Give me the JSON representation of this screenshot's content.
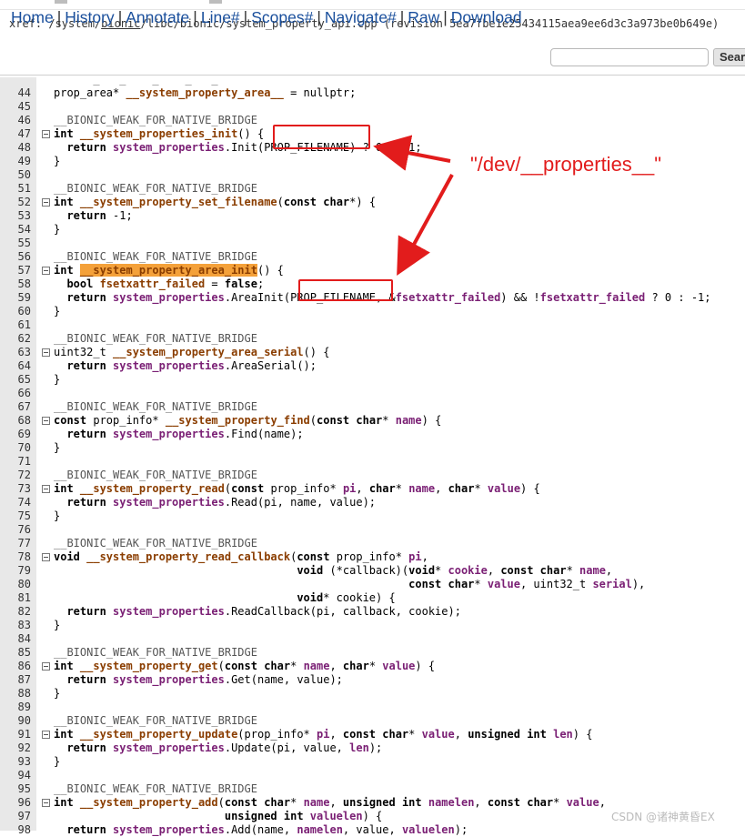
{
  "xref": {
    "prefix": "xref: /system/",
    "bionic_link": "bionic",
    "rest": "/libc/bionic/system_property_api.cpp (revision 5ea7fbe1e25434115aea9ee6d3c3a973be0b649e)"
  },
  "nav": {
    "items": [
      "Home",
      "History",
      "Annotate",
      "Line#",
      "Scopes#",
      "Navigate#",
      "Raw",
      "Download"
    ],
    "search_button": "Sear"
  },
  "annotation": {
    "text": "\"/dev/__properties__\"",
    "color": "#e21c1c"
  },
  "watermark": "CSDN @诸神黄昏EX",
  "colors": {
    "highlight": "#f4a13a",
    "function": "#8a3d00",
    "identifier": "#7a1f74",
    "nav_link": "#1a4f9c"
  },
  "lines": [
    {
      "n": "",
      "fold": false,
      "tokens": [
        [
          "      _   _    _    _   _   ",
          "mac"
        ]
      ]
    },
    {
      "n": "44",
      "fold": false,
      "tokens": [
        [
          "prop_area* ",
          ""
        ],
        [
          "__system_property_area__",
          "fn"
        ],
        [
          " = nullptr;",
          ""
        ]
      ]
    },
    {
      "n": "45",
      "fold": false,
      "tokens": []
    },
    {
      "n": "46",
      "fold": false,
      "tokens": [
        [
          "__BIONIC_WEAK_FOR_NATIVE_BRIDGE",
          "mac"
        ]
      ]
    },
    {
      "n": "47",
      "fold": true,
      "tokens": [
        [
          "int ",
          "kw"
        ],
        [
          "__system_properties_init",
          "fn"
        ],
        [
          "() {",
          ""
        ]
      ]
    },
    {
      "n": "48",
      "fold": false,
      "tokens": [
        [
          "  ",
          ""
        ],
        [
          "return ",
          "kw"
        ],
        [
          "system_properties",
          "var"
        ],
        [
          ".Init(PROP_FILENAME) ? 0 : -1;",
          ""
        ]
      ]
    },
    {
      "n": "49",
      "fold": false,
      "tokens": [
        [
          "}",
          ""
        ]
      ]
    },
    {
      "n": "50",
      "fold": false,
      "tokens": []
    },
    {
      "n": "51",
      "fold": false,
      "tokens": [
        [
          "__BIONIC_WEAK_FOR_NATIVE_BRIDGE",
          "mac"
        ]
      ]
    },
    {
      "n": "52",
      "fold": true,
      "tokens": [
        [
          "int ",
          "kw"
        ],
        [
          "__system_property_set_filename",
          "fn"
        ],
        [
          "(",
          ""
        ],
        [
          "const char",
          "kw"
        ],
        [
          "*) {",
          ""
        ]
      ]
    },
    {
      "n": "53",
      "fold": false,
      "tokens": [
        [
          "  ",
          ""
        ],
        [
          "return ",
          "kw"
        ],
        [
          "-1;",
          ""
        ]
      ]
    },
    {
      "n": "54",
      "fold": false,
      "tokens": [
        [
          "}",
          ""
        ]
      ]
    },
    {
      "n": "55",
      "fold": false,
      "tokens": []
    },
    {
      "n": "56",
      "fold": false,
      "tokens": [
        [
          "__BIONIC_WEAK_FOR_NATIVE_BRIDGE",
          "mac"
        ]
      ]
    },
    {
      "n": "57",
      "fold": true,
      "tokens": [
        [
          "int ",
          "kw"
        ],
        [
          "__system_property_area_init",
          "fn hl"
        ],
        [
          "() {",
          ""
        ]
      ]
    },
    {
      "n": "58",
      "fold": false,
      "tokens": [
        [
          "  ",
          ""
        ],
        [
          "bool ",
          "kw"
        ],
        [
          "fsetxattr_failed",
          "fn"
        ],
        [
          " = ",
          ""
        ],
        [
          "false",
          "kw"
        ],
        [
          ";",
          ""
        ]
      ]
    },
    {
      "n": "59",
      "fold": false,
      "tokens": [
        [
          "  ",
          ""
        ],
        [
          "return ",
          "kw"
        ],
        [
          "system_properties",
          "var"
        ],
        [
          ".AreaInit(PROP_FILENAME, &",
          ""
        ],
        [
          "fsetxattr_failed",
          "var"
        ],
        [
          ") && !",
          ""
        ],
        [
          "fsetxattr_failed",
          "var"
        ],
        [
          " ? 0 : -1;",
          ""
        ]
      ]
    },
    {
      "n": "60",
      "fold": false,
      "tokens": [
        [
          "}",
          ""
        ]
      ]
    },
    {
      "n": "61",
      "fold": false,
      "tokens": []
    },
    {
      "n": "62",
      "fold": false,
      "tokens": [
        [
          "__BIONIC_WEAK_FOR_NATIVE_BRIDGE",
          "mac"
        ]
      ]
    },
    {
      "n": "63",
      "fold": true,
      "tokens": [
        [
          "uint32_t ",
          ""
        ],
        [
          "__system_property_area_serial",
          "fn"
        ],
        [
          "() {",
          ""
        ]
      ]
    },
    {
      "n": "64",
      "fold": false,
      "tokens": [
        [
          "  ",
          ""
        ],
        [
          "return ",
          "kw"
        ],
        [
          "system_properties",
          "var"
        ],
        [
          ".AreaSerial();",
          ""
        ]
      ]
    },
    {
      "n": "65",
      "fold": false,
      "tokens": [
        [
          "}",
          ""
        ]
      ]
    },
    {
      "n": "66",
      "fold": false,
      "tokens": []
    },
    {
      "n": "67",
      "fold": false,
      "tokens": [
        [
          "__BIONIC_WEAK_FOR_NATIVE_BRIDGE",
          "mac"
        ]
      ]
    },
    {
      "n": "68",
      "fold": true,
      "tokens": [
        [
          "const ",
          "kw"
        ],
        [
          "prop_info* ",
          ""
        ],
        [
          "__system_property_find",
          "fn"
        ],
        [
          "(",
          ""
        ],
        [
          "const char",
          "kw"
        ],
        [
          "* ",
          ""
        ],
        [
          "name",
          "var"
        ],
        [
          ") {",
          ""
        ]
      ]
    },
    {
      "n": "69",
      "fold": false,
      "tokens": [
        [
          "  ",
          ""
        ],
        [
          "return ",
          "kw"
        ],
        [
          "system_properties",
          "var"
        ],
        [
          ".Find(name);",
          ""
        ]
      ]
    },
    {
      "n": "70",
      "fold": false,
      "tokens": [
        [
          "}",
          ""
        ]
      ]
    },
    {
      "n": "71",
      "fold": false,
      "tokens": []
    },
    {
      "n": "72",
      "fold": false,
      "tokens": [
        [
          "__BIONIC_WEAK_FOR_NATIVE_BRIDGE",
          "mac"
        ]
      ]
    },
    {
      "n": "73",
      "fold": true,
      "tokens": [
        [
          "int ",
          "kw"
        ],
        [
          "__system_property_read",
          "fn"
        ],
        [
          "(",
          ""
        ],
        [
          "const ",
          "kw"
        ],
        [
          "prop_info* ",
          ""
        ],
        [
          "pi",
          "var"
        ],
        [
          ", ",
          ""
        ],
        [
          "char",
          "kw"
        ],
        [
          "* ",
          ""
        ],
        [
          "name",
          "var"
        ],
        [
          ", ",
          ""
        ],
        [
          "char",
          "kw"
        ],
        [
          "* ",
          ""
        ],
        [
          "value",
          "var"
        ],
        [
          ") {",
          ""
        ]
      ]
    },
    {
      "n": "74",
      "fold": false,
      "tokens": [
        [
          "  ",
          ""
        ],
        [
          "return ",
          "kw"
        ],
        [
          "system_properties",
          "var"
        ],
        [
          ".Read(pi, name, value);",
          ""
        ]
      ]
    },
    {
      "n": "75",
      "fold": false,
      "tokens": [
        [
          "}",
          ""
        ]
      ]
    },
    {
      "n": "76",
      "fold": false,
      "tokens": []
    },
    {
      "n": "77",
      "fold": false,
      "tokens": [
        [
          "__BIONIC_WEAK_FOR_NATIVE_BRIDGE",
          "mac"
        ]
      ]
    },
    {
      "n": "78",
      "fold": true,
      "tokens": [
        [
          "void ",
          "kw"
        ],
        [
          "__system_property_read_callback",
          "fn"
        ],
        [
          "(",
          ""
        ],
        [
          "const ",
          "kw"
        ],
        [
          "prop_info* ",
          ""
        ],
        [
          "pi",
          "var"
        ],
        [
          ",",
          ""
        ]
      ]
    },
    {
      "n": "79",
      "fold": false,
      "tokens": [
        [
          "                                     ",
          ""
        ],
        [
          "void ",
          "kw"
        ],
        [
          "(*callback)(",
          ""
        ],
        [
          "void",
          "kw"
        ],
        [
          "* ",
          ""
        ],
        [
          "cookie",
          "var"
        ],
        [
          ", ",
          ""
        ],
        [
          "const char",
          "kw"
        ],
        [
          "* ",
          ""
        ],
        [
          "name",
          "var"
        ],
        [
          ",",
          ""
        ]
      ]
    },
    {
      "n": "80",
      "fold": false,
      "tokens": [
        [
          "                                                      ",
          ""
        ],
        [
          "const char",
          "kw"
        ],
        [
          "* ",
          ""
        ],
        [
          "value",
          "var"
        ],
        [
          ", uint32_t ",
          ""
        ],
        [
          "serial",
          "var"
        ],
        [
          "),",
          ""
        ]
      ]
    },
    {
      "n": "81",
      "fold": false,
      "tokens": [
        [
          "                                     ",
          ""
        ],
        [
          "void",
          "kw"
        ],
        [
          "* cookie) {",
          ""
        ]
      ]
    },
    {
      "n": "82",
      "fold": false,
      "tokens": [
        [
          "  ",
          ""
        ],
        [
          "return ",
          "kw"
        ],
        [
          "system_properties",
          "var"
        ],
        [
          ".ReadCallback(pi, callback, cookie);",
          ""
        ]
      ]
    },
    {
      "n": "83",
      "fold": false,
      "tokens": [
        [
          "}",
          ""
        ]
      ]
    },
    {
      "n": "84",
      "fold": false,
      "tokens": []
    },
    {
      "n": "85",
      "fold": false,
      "tokens": [
        [
          "__BIONIC_WEAK_FOR_NATIVE_BRIDGE",
          "mac"
        ]
      ]
    },
    {
      "n": "86",
      "fold": true,
      "tokens": [
        [
          "int ",
          "kw"
        ],
        [
          "__system_property_get",
          "fn"
        ],
        [
          "(",
          ""
        ],
        [
          "const char",
          "kw"
        ],
        [
          "* ",
          ""
        ],
        [
          "name",
          "var"
        ],
        [
          ", ",
          ""
        ],
        [
          "char",
          "kw"
        ],
        [
          "* ",
          ""
        ],
        [
          "value",
          "var"
        ],
        [
          ") {",
          ""
        ]
      ]
    },
    {
      "n": "87",
      "fold": false,
      "tokens": [
        [
          "  ",
          ""
        ],
        [
          "return ",
          "kw"
        ],
        [
          "system_properties",
          "var"
        ],
        [
          ".Get(name, value);",
          ""
        ]
      ]
    },
    {
      "n": "88",
      "fold": false,
      "tokens": [
        [
          "}",
          ""
        ]
      ]
    },
    {
      "n": "89",
      "fold": false,
      "tokens": []
    },
    {
      "n": "90",
      "fold": false,
      "tokens": [
        [
          "__BIONIC_WEAK_FOR_NATIVE_BRIDGE",
          "mac"
        ]
      ]
    },
    {
      "n": "91",
      "fold": true,
      "tokens": [
        [
          "int ",
          "kw"
        ],
        [
          "__system_property_update",
          "fn"
        ],
        [
          "(prop_info* ",
          ""
        ],
        [
          "pi",
          "var"
        ],
        [
          ", ",
          ""
        ],
        [
          "const char",
          "kw"
        ],
        [
          "* ",
          ""
        ],
        [
          "value",
          "var"
        ],
        [
          ", ",
          ""
        ],
        [
          "unsigned int ",
          "kw"
        ],
        [
          "len",
          "var"
        ],
        [
          ") {",
          ""
        ]
      ]
    },
    {
      "n": "92",
      "fold": false,
      "tokens": [
        [
          "  ",
          ""
        ],
        [
          "return ",
          "kw"
        ],
        [
          "system_properties",
          "var"
        ],
        [
          ".Update(pi, value, ",
          ""
        ],
        [
          "len",
          "var"
        ],
        [
          ");",
          ""
        ]
      ]
    },
    {
      "n": "93",
      "fold": false,
      "tokens": [
        [
          "}",
          ""
        ]
      ]
    },
    {
      "n": "94",
      "fold": false,
      "tokens": []
    },
    {
      "n": "95",
      "fold": false,
      "tokens": [
        [
          "__BIONIC_WEAK_FOR_NATIVE_BRIDGE",
          "mac"
        ]
      ]
    },
    {
      "n": "96",
      "fold": true,
      "tokens": [
        [
          "int ",
          "kw"
        ],
        [
          "__system_property_add",
          "fn"
        ],
        [
          "(",
          ""
        ],
        [
          "const char",
          "kw"
        ],
        [
          "* ",
          ""
        ],
        [
          "name",
          "var"
        ],
        [
          ", ",
          ""
        ],
        [
          "unsigned int ",
          "kw"
        ],
        [
          "namelen",
          "var"
        ],
        [
          ", ",
          ""
        ],
        [
          "const char",
          "kw"
        ],
        [
          "* ",
          ""
        ],
        [
          "value",
          "var"
        ],
        [
          ",",
          ""
        ]
      ]
    },
    {
      "n": "97",
      "fold": false,
      "tokens": [
        [
          "                          ",
          ""
        ],
        [
          "unsigned int ",
          "kw"
        ],
        [
          "valuelen",
          "var"
        ],
        [
          ") {",
          ""
        ]
      ]
    },
    {
      "n": "98",
      "fold": false,
      "tokens": [
        [
          "  ",
          ""
        ],
        [
          "return ",
          "kw"
        ],
        [
          "system_properties",
          "var"
        ],
        [
          ".Add(name, ",
          ""
        ],
        [
          "namelen",
          "var"
        ],
        [
          ", value, ",
          ""
        ],
        [
          "valuelen",
          "var"
        ],
        [
          ");",
          ""
        ]
      ]
    }
  ]
}
